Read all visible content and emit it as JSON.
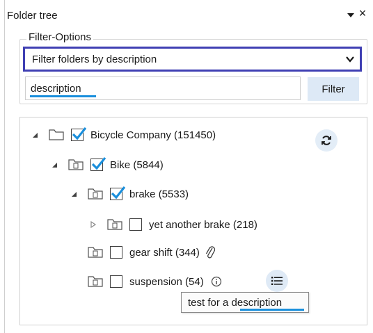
{
  "panel": {
    "title": "Folder tree",
    "pin_icon": "pin-dropdown-icon",
    "close_label": "×"
  },
  "filter_options": {
    "label": "Filter-Options",
    "mode_selected": "Filter folders by description",
    "search_value": "description",
    "filter_button": "Filter"
  },
  "tree": {
    "items": [
      {
        "label": "Bicycle Company (151450)",
        "expanded": true,
        "checked": true
      },
      {
        "label": "Bike (5844)",
        "expanded": true,
        "checked": true
      },
      {
        "label": "brake (5533)",
        "expanded": true,
        "checked": true
      },
      {
        "label": "yet another brake (218)",
        "expanded": false,
        "checked": false
      },
      {
        "label": "gear shift (344)",
        "checked": false,
        "attachment": true
      },
      {
        "label": "suspension (54)",
        "checked": false,
        "info": true
      }
    ]
  },
  "tooltip": {
    "text": "test for a description"
  },
  "colors": {
    "accent_blue": "#1a8fdc",
    "select_border": "#3f3fb3",
    "button_bg": "#dde9f6"
  }
}
